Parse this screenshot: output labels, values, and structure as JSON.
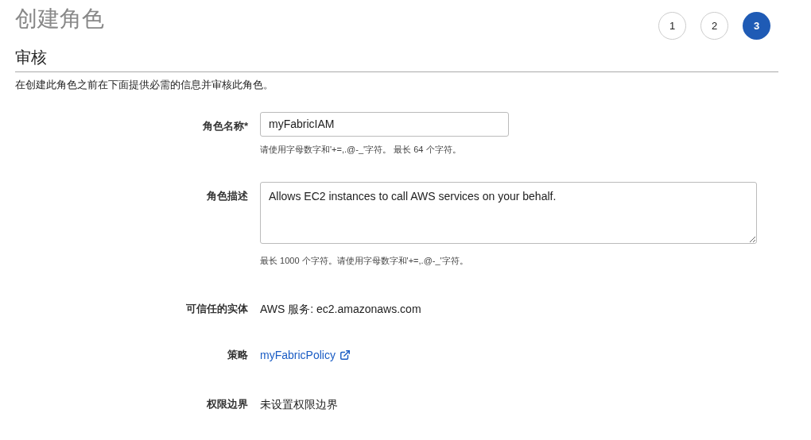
{
  "page_title": "创建角色",
  "steps": [
    {
      "label": "1",
      "selected": false
    },
    {
      "label": "2",
      "selected": false
    },
    {
      "label": "3",
      "selected": true
    }
  ],
  "section_title": "审核",
  "intro": "在创建此角色之前在下面提供必需的信息并审核此角色。",
  "fields": [
    {
      "kind": "input",
      "label": "角色名称*",
      "value": "myFabricIAM",
      "hint": "请使用字母数字和'+=,.@-_'字符。 最长 64 个字符。"
    },
    {
      "kind": "textarea",
      "label": "角色描述",
      "value": "Allows EC2 instances to call AWS services on your behalf.",
      "hint": "最长 1000 个字符。请使用字母数字和'+=,.@-_'字符。"
    },
    {
      "kind": "text",
      "label": "可信任的实体",
      "value": "AWS 服务: ec2.amazonaws.com"
    },
    {
      "kind": "link",
      "label": "策略",
      "value": "myFabricPolicy"
    },
    {
      "kind": "text",
      "label": "权限边界",
      "value": "未设置权限边界"
    }
  ]
}
